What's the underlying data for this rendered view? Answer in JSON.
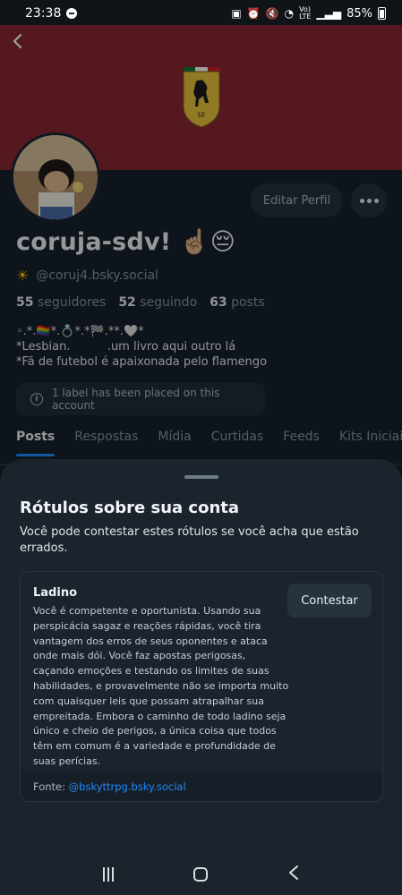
{
  "status_bar": {
    "time": "23:38",
    "battery": "85%"
  },
  "profile": {
    "edit_label": "Editar Perfil",
    "display_name": "coruja-sdv! ☝🏼😔",
    "handle": "@coruj4.bsky.social",
    "followers_count": "55",
    "followers_label": "seguidores",
    "following_count": "52",
    "following_label": "seguindo",
    "posts_count": "63",
    "posts_label": "posts",
    "bio": "◦.*.🏳️‍🌈*.💍*.*🏁.**.🤍*\n*Lesbian.          .um livro aqui outro lá\n*Fã de futebol é apaixonada pelo flamengo",
    "label_notice": "1 label has been placed on this account"
  },
  "tabs": [
    {
      "label": "Posts"
    },
    {
      "label": "Respostas"
    },
    {
      "label": "Mídia"
    },
    {
      "label": "Curtidas"
    },
    {
      "label": "Feeds"
    },
    {
      "label": "Kits Iniciais"
    }
  ],
  "sheet": {
    "title": "Rótulos sobre sua conta",
    "description": "Você pode contestar estes rótulos se você acha que estão errados.",
    "label": {
      "name": "Ladino",
      "text": "Você é competente e oportunista. Usando sua perspicácia sagaz e reações rápidas, você tira vantagem dos erros de seus oponentes e ataca onde mais dói. Você faz apostas perigosas, caçando emoções e testando os limites de suas habilidades, e provavelmente não se importa muito com quaisquer leis que possam atrapalhar sua empreitada. Embora o caminho de todo ladino seja único e cheio de perigos, a única coisa que todos têm em comum é a variedade e profundidade de suas perícias.",
      "appeal_label": "Contestar",
      "source_prefix": "Fonte: ",
      "source_handle": "@bskyttrpg.bsky.social"
    }
  },
  "colors": {
    "banner": "#8b2732",
    "accent": "#208bfe",
    "background": "#17212c"
  }
}
